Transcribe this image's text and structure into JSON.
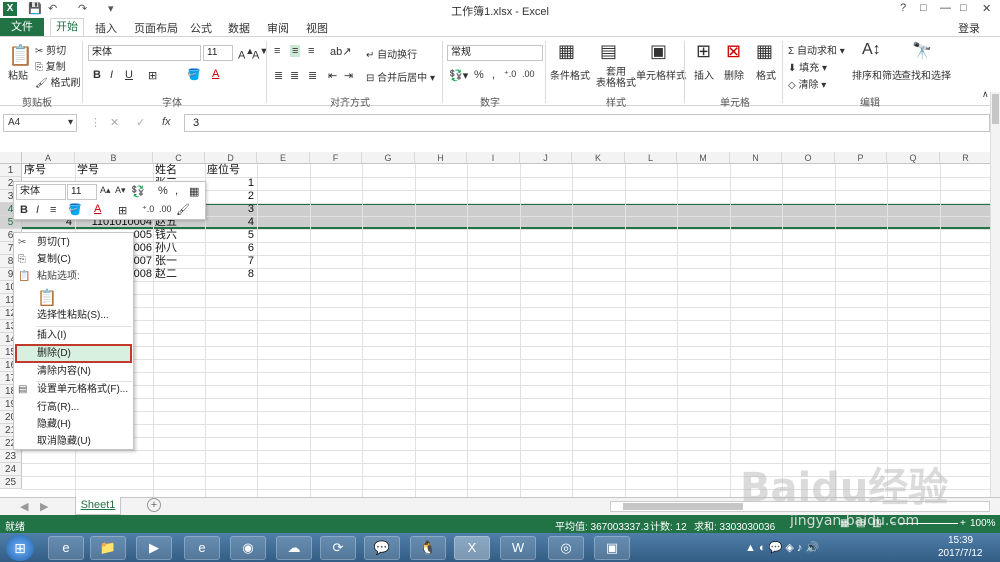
{
  "window": {
    "title": "工作簿1.xlsx - Excel",
    "controls": [
      "?",
      "□",
      "—",
      "□",
      "✕"
    ],
    "login": "登录"
  },
  "tabs": [
    "文件",
    "开始",
    "插入",
    "页面布局",
    "公式",
    "数据",
    "审阅",
    "视图"
  ],
  "ribbon": {
    "clipboard": {
      "paste": "粘贴",
      "cut": "剪切",
      "copy": "复制",
      "format_painter": "格式刷",
      "label": "剪贴板"
    },
    "font": {
      "name": "宋体",
      "size": "11",
      "label": "字体",
      "bold": "B",
      "italic": "I",
      "underline": "U"
    },
    "alignment": {
      "wrap": "自动换行",
      "merge": "合并后居中",
      "label": "对齐方式"
    },
    "number": {
      "format": "常规",
      "label": "数字",
      "percent": "%",
      "comma": ","
    },
    "styles": {
      "conditional": "条件格式",
      "table": "套用\n表格格式",
      "cell_styles": "单元格样式",
      "label": "样式"
    },
    "cells": {
      "insert": "插入",
      "delete": "删除",
      "format": "格式",
      "label": "单元格"
    },
    "editing": {
      "autosum": "自动求和",
      "fill": "填充",
      "clear": "清除",
      "sort": "排序和筛选",
      "find": "查找和选择",
      "label": "编辑"
    }
  },
  "formula_bar": {
    "name_box": "A4",
    "fx": "fx",
    "value": "3"
  },
  "columns": [
    "A",
    "B",
    "C",
    "D",
    "E",
    "F",
    "G",
    "H",
    "I",
    "J",
    "K",
    "L",
    "M",
    "N",
    "O",
    "P",
    "Q",
    "R"
  ],
  "rows": [
    "1",
    "2",
    "3",
    "4",
    "5",
    "6",
    "7",
    "8",
    "9",
    "10",
    "11",
    "12",
    "13",
    "14",
    "15",
    "16",
    "17",
    "18",
    "19",
    "20",
    "21",
    "22",
    "23",
    "24",
    "25"
  ],
  "cells": {
    "A1": "序号",
    "B1": "学号",
    "C1": "姓名",
    "D1": "座位号",
    "C2": "张三",
    "D2": "1",
    "D3": "2",
    "D4": "3",
    "D5": "4",
    "D6": "5",
    "D7": "6",
    "D8": "7",
    "D9": "8",
    "A5": "4",
    "B5": "1101010004",
    "C5": "赵五",
    "B6": "005",
    "C6": "钱六",
    "B7": "006",
    "C7": "孙八",
    "B8": "007",
    "C8": "张一",
    "B9": "008",
    "C9": "赵二"
  },
  "mini_toolbar": {
    "font": "宋体",
    "size": "11",
    "percent": "%",
    "comma": ","
  },
  "context_menu": {
    "cut": "剪切(T)",
    "copy": "复制(C)",
    "paste_options": "粘贴选项:",
    "paste_special": "选择性粘贴(S)...",
    "insert": "插入(I)",
    "delete": "删除(D)",
    "clear": "清除内容(N)",
    "format_cells": "设置单元格格式(F)...",
    "row_height": "行高(R)...",
    "hide": "隐藏(H)",
    "unhide": "取消隐藏(U)"
  },
  "sheet_tab": "Sheet1",
  "status_bar": {
    "ready": "就绪",
    "average": "平均值: 367003337.3",
    "count": "计数: 12",
    "sum": "求和: 3303030036",
    "zoom": "100%"
  },
  "watermark": {
    "text": "Baidu经验",
    "url": "jingyan.baidu.com"
  },
  "taskbar": {
    "time": "15:39",
    "date": "2017/7/12"
  },
  "colors": {
    "excel_green": "#217346",
    "selection_gray": "#cdcdcd",
    "delete_highlight": "#c0392b"
  }
}
